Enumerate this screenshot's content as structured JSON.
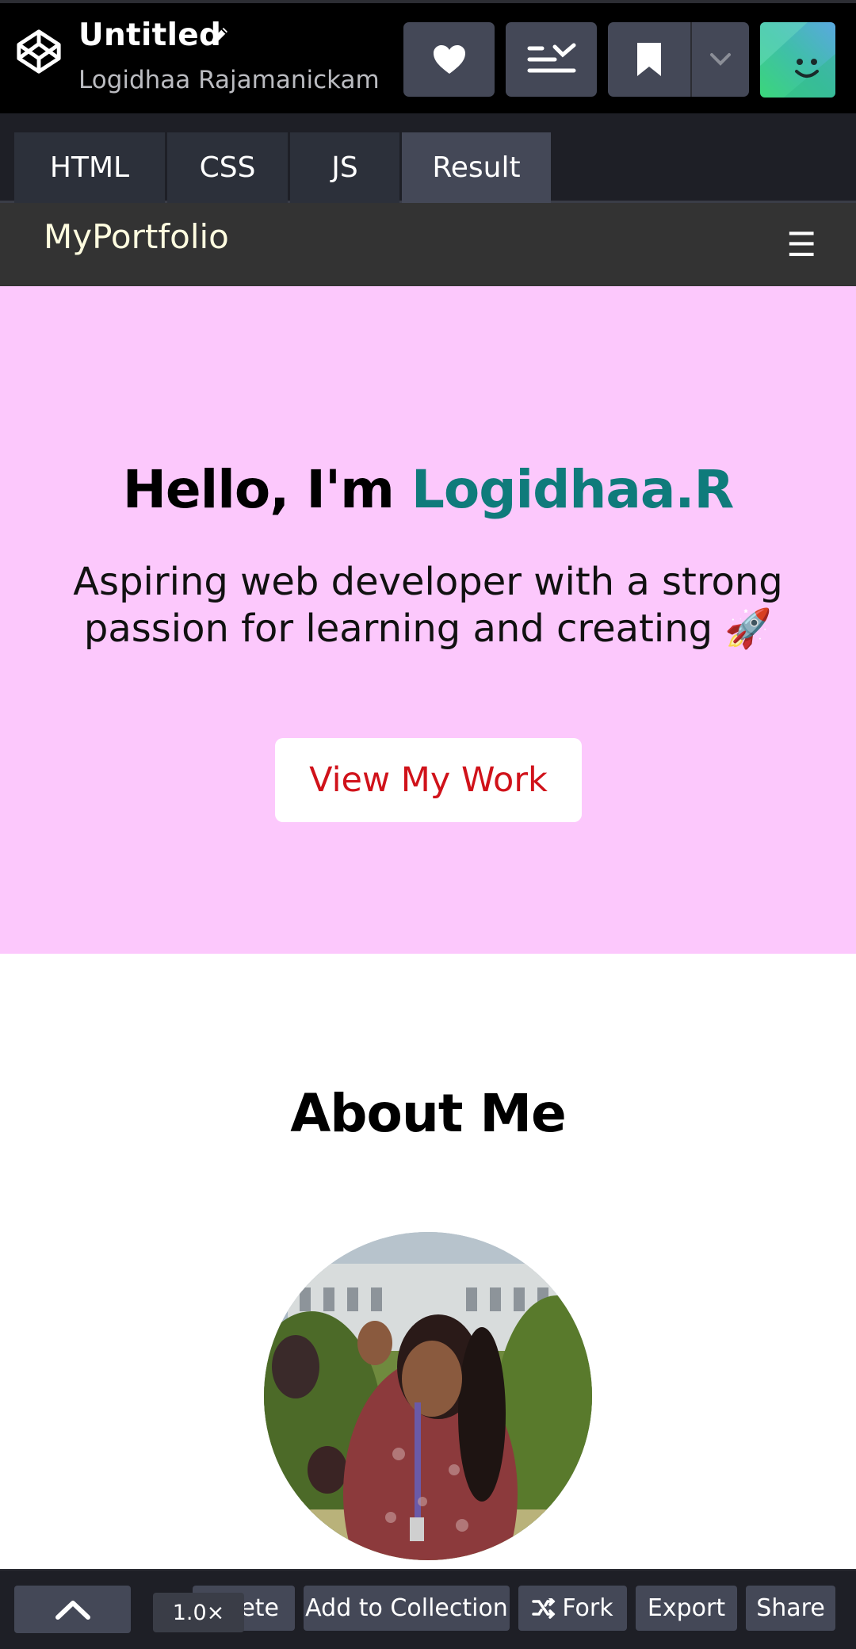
{
  "header": {
    "title": "Untitled",
    "author": "Logidhaa Rajamanickam"
  },
  "tabs": {
    "html": "HTML",
    "css": "CSS",
    "js": "JS",
    "result": "Result"
  },
  "site": {
    "brand": "MyPortfolio",
    "menu_glyph": "☰",
    "hero_greeting": "Hello, I'm ",
    "hero_name": "Logidhaa.R",
    "hero_subtitle": "Aspiring web developer with a strong passion for learning and creating 🚀",
    "hero_button": "View My Work",
    "about_title": "About Me"
  },
  "footer": {
    "zoom": "1.0×",
    "delete_label": "ete",
    "collection_label": "Add to Collection",
    "fork_label": "Fork",
    "export_label": "Export",
    "share_label": "Share"
  },
  "colors": {
    "hero_background": "#fcc8fc",
    "name_accent": "#0f7b7b",
    "button_text": "#d0121a",
    "nav_background": "#333333"
  }
}
